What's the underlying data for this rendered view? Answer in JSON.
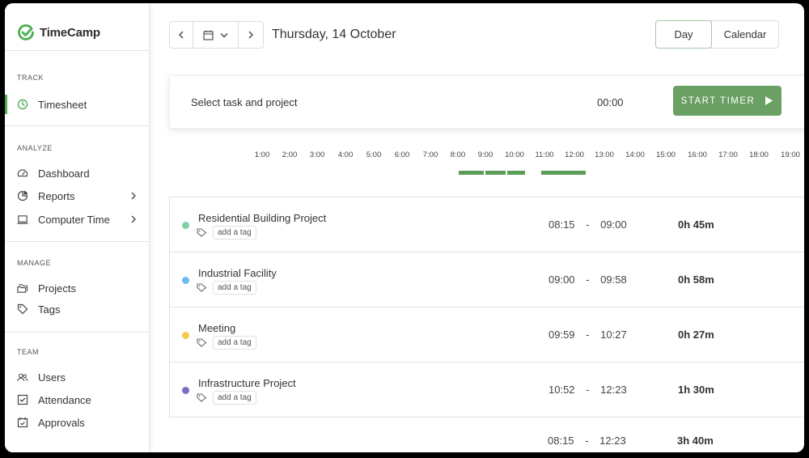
{
  "app": {
    "name": "TimeCamp",
    "brand_color": "#4caf50"
  },
  "sidebar": {
    "sections": [
      {
        "title": "TRACK"
      },
      {
        "title": "ANALYZE"
      },
      {
        "title": "MANAGE"
      },
      {
        "title": "TEAM"
      }
    ],
    "items": [
      {
        "label": "Timesheet",
        "icon": "clock-icon",
        "active": true
      },
      {
        "label": "Dashboard",
        "icon": "gauge-icon"
      },
      {
        "label": "Reports",
        "icon": "pie-chart-icon",
        "has_chevron": true
      },
      {
        "label": "Computer Time",
        "icon": "laptop-icon",
        "has_chevron": true
      },
      {
        "label": "Projects",
        "icon": "folders-icon"
      },
      {
        "label": "Tags",
        "icon": "tag-icon"
      },
      {
        "label": "Users",
        "icon": "users-icon"
      },
      {
        "label": "Attendance",
        "icon": "checkbox-icon"
      },
      {
        "label": "Approvals",
        "icon": "calendar-check-icon"
      }
    ]
  },
  "header": {
    "date": "Thursday, 14 October",
    "view_day": "Day",
    "view_calendar": "Calendar"
  },
  "timer": {
    "task_placeholder": "Select task and project",
    "elapsed": "00:00",
    "start_label": "START TIMER",
    "accent": "#6aa064"
  },
  "timeline": {
    "hours": [
      "1:00",
      "2:00",
      "3:00",
      "4:00",
      "5:00",
      "6:00",
      "7:00",
      "8:00",
      "9:00",
      "10:00",
      "11:00",
      "12:00",
      "13:00",
      "14:00",
      "15:00",
      "16:00",
      "17:00",
      "18:00",
      "19:00"
    ]
  },
  "entries": [
    {
      "name": "Residential Building Project",
      "tag_label": "add a tag",
      "start": "08:15",
      "end": "09:00",
      "duration": "0h 45m",
      "color": "#7fd1a3"
    },
    {
      "name": "Industrial Facility",
      "tag_label": "add a tag",
      "start": "09:00",
      "end": "09:58",
      "duration": "0h 58m",
      "color": "#6cbcf2"
    },
    {
      "name": "Meeting",
      "tag_label": "add a tag",
      "start": "09:59",
      "end": "10:27",
      "duration": "0h 27m",
      "color": "#f2c94c"
    },
    {
      "name": "Infrastructure Project",
      "tag_label": "add a tag",
      "start": "10:52",
      "end": "12:23",
      "duration": "1h 30m",
      "color": "#7b6cc4"
    }
  ],
  "total": {
    "start": "08:15",
    "end": "12:23",
    "duration": "3h 40m"
  }
}
